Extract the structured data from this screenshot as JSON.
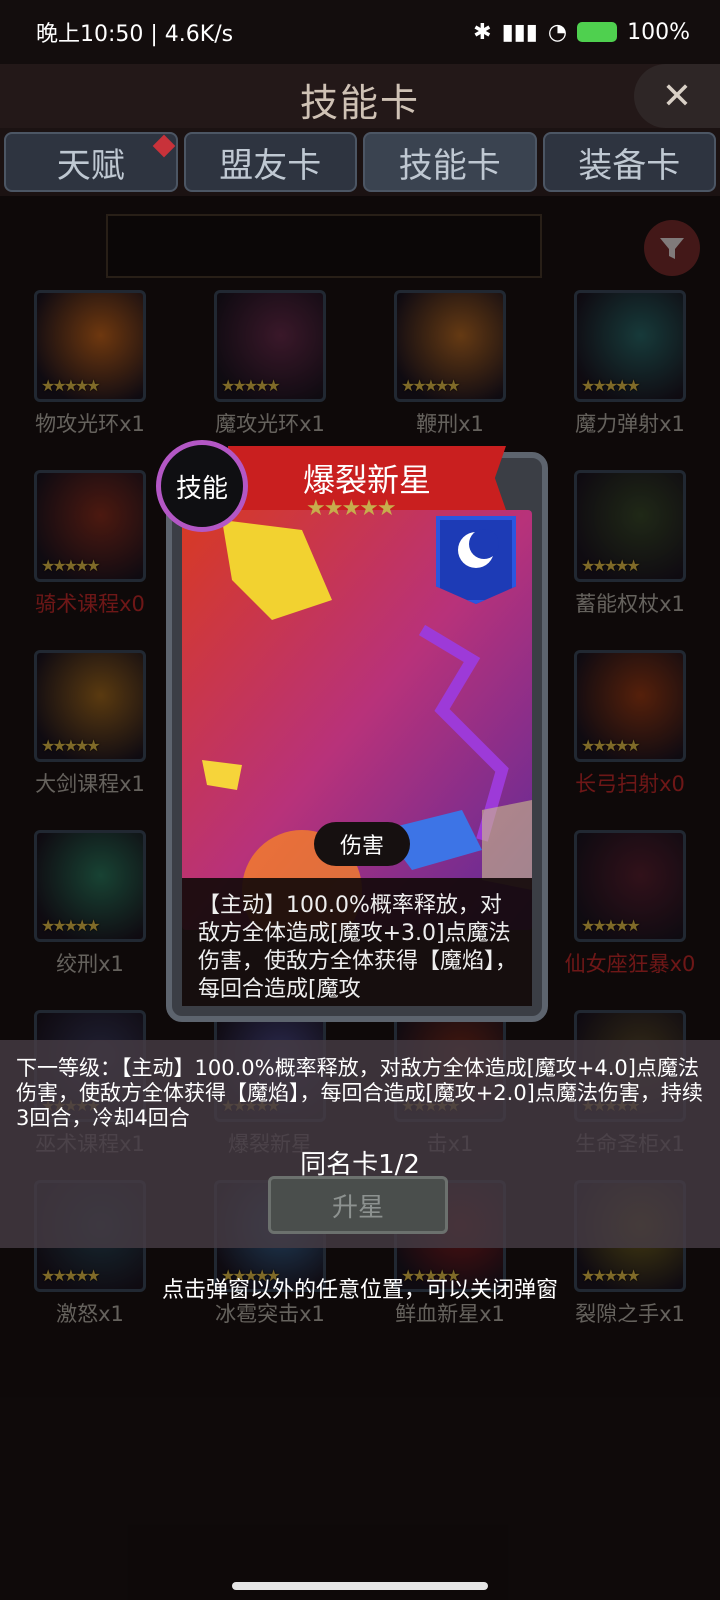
{
  "status_bar": {
    "time_speed": "晚上10:50 | 4.6K/s",
    "battery": "100%"
  },
  "header": {
    "title": "技能卡"
  },
  "tabs": [
    {
      "label": "天赋",
      "badge": true
    },
    {
      "label": "盟友卡"
    },
    {
      "label": "技能卡"
    },
    {
      "label": "装备卡"
    }
  ],
  "cards": [
    {
      "label": "物攻光环x1",
      "stars": "★★★★★",
      "red": false
    },
    {
      "label": "魔攻光环x1",
      "stars": "★★★★★",
      "red": false
    },
    {
      "label": "鞭刑x1",
      "stars": "★★★★★",
      "red": false
    },
    {
      "label": "魔力弹射x1",
      "stars": "★★★★★",
      "red": false
    },
    {
      "label": "骑术课程x0",
      "stars": "★★★★★",
      "red": true
    },
    {
      "label": "蓄能权杖x1",
      "stars": "★★★★★",
      "red": false
    },
    {
      "label": "大剑课程x1",
      "stars": "★★★★★",
      "red": false
    },
    {
      "label": "长弓扫射x0",
      "stars": "★★★★★",
      "red": true
    },
    {
      "label": "绞刑x1",
      "stars": "★★★★★",
      "red": false
    },
    {
      "label": "仙女座狂暴x0",
      "stars": "★★★★★",
      "red": true
    },
    {
      "label": "巫术课程x1",
      "stars": "★★★★★",
      "red": false
    },
    {
      "label": "爆裂新星",
      "stars": "★★★★★",
      "red": false
    },
    {
      "label": "击x1",
      "stars": "★★★★★",
      "red": false
    },
    {
      "label": "生命圣柜x1",
      "stars": "★★★★★",
      "red": false
    },
    {
      "label": "激怒x1",
      "stars": "★★★★★",
      "red": false
    },
    {
      "label": "冰雹突击x1",
      "stars": "★★★★★",
      "red": false
    },
    {
      "label": "鲜血新星x1",
      "stars": "★★★★★",
      "red": false
    },
    {
      "label": "裂隙之手x1",
      "stars": "★★★★★",
      "red": false
    }
  ],
  "popup": {
    "type_badge": "技能",
    "name": "爆裂新星",
    "stars": "★★★★★",
    "tag": "伤害",
    "description": "【主动】100.0%概率释放，对敌方全体造成[魔攻+3.0]点魔法伤害，使敌方全体获得【魔焰】，每回合造成[魔攻",
    "next_level": "下一等级：【主动】100.0%概率释放，对敌方全体造成[魔攻+4.0]点魔法伤害，使敌方全体获得【魔焰】，每回合造成[魔攻+2.0]点魔法伤害，持续3回合，冷却4回合",
    "duplicates": "同名卡1/2",
    "upgrade_label": "升星",
    "close_hint": "点击弹窗以外的任意位置，可以关闭弹窗"
  },
  "colors": {
    "rare_red": "#c82a2a",
    "popup_ribbon": "#c91f1f",
    "badge_purple": "#b357c5"
  }
}
